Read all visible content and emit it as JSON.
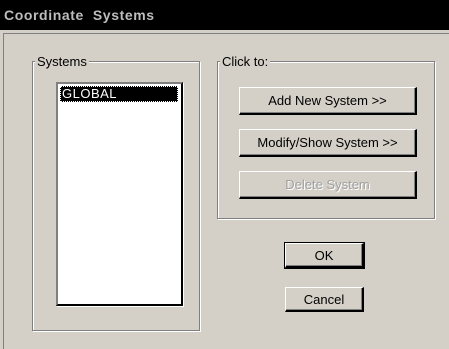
{
  "window": {
    "title": "Coordinate  Systems"
  },
  "systems": {
    "label": "Systems",
    "items": [
      {
        "label": "GLOBAL",
        "selected": true
      }
    ]
  },
  "actions": {
    "label": "Click to:",
    "add_label": "Add New System >>",
    "modify_label": "Modify/Show System >>",
    "delete_label": "Delete System"
  },
  "dialog": {
    "ok_label": "OK",
    "cancel_label": "Cancel"
  }
}
